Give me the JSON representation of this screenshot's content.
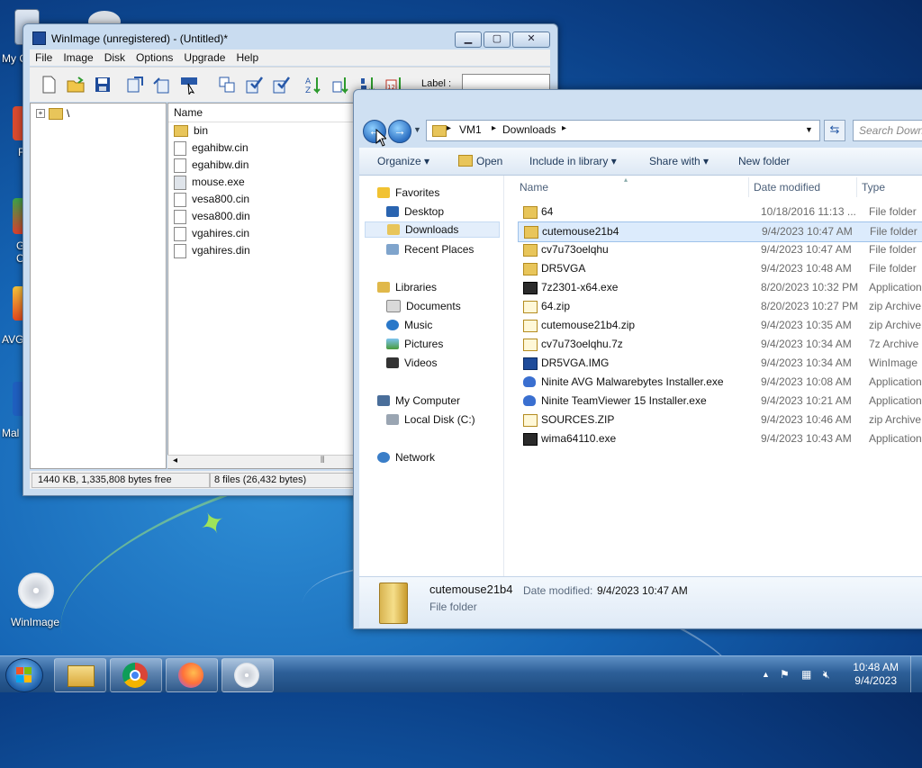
{
  "desktop": {
    "icons": [
      {
        "label": "My C"
      },
      {
        "label": "F"
      },
      {
        "label": "G"
      },
      {
        "label": "C"
      },
      {
        "label": "AVG"
      },
      {
        "label": "Mal"
      },
      {
        "label": "WinImage"
      }
    ]
  },
  "winimage": {
    "title": "WinImage (unregistered) - (Untitled)*",
    "menu": [
      "File",
      "Image",
      "Disk",
      "Options",
      "Upgrade",
      "Help"
    ],
    "label_caption": "Label :",
    "label_value": "",
    "tree_root": "\\",
    "list_header": "Name",
    "files": [
      {
        "name": "bin",
        "kind": "folder"
      },
      {
        "name": "egahibw.cin",
        "kind": "file"
      },
      {
        "name": "egahibw.din",
        "kind": "file"
      },
      {
        "name": "mouse.exe",
        "kind": "exe"
      },
      {
        "name": "vesa800.cin",
        "kind": "file"
      },
      {
        "name": "vesa800.din",
        "kind": "file"
      },
      {
        "name": "vgahires.cin",
        "kind": "file"
      },
      {
        "name": "vgahires.din",
        "kind": "file"
      }
    ],
    "status_left": "1440 KB, 1,335,808 bytes free",
    "status_right": "8 files (26,432 bytes)"
  },
  "explorer": {
    "breadcrumb": [
      "VM1",
      "Downloads"
    ],
    "search_placeholder": "Search Downlo",
    "commands": {
      "organize": "Organize",
      "open": "Open",
      "include": "Include in library",
      "share": "Share with",
      "new_folder": "New folder"
    },
    "nav": {
      "favorites": "Favorites",
      "desktop": "Desktop",
      "downloads": "Downloads",
      "recent": "Recent Places",
      "libraries": "Libraries",
      "documents": "Documents",
      "music": "Music",
      "pictures": "Pictures",
      "videos": "Videos",
      "computer": "My Computer",
      "localdisk": "Local Disk (C:)",
      "network": "Network"
    },
    "columns": {
      "name": "Name",
      "date": "Date modified",
      "type": "Type"
    },
    "files": [
      {
        "name": "64",
        "date": "10/18/2016 11:13 ...",
        "type": "File folder",
        "icon": "folder"
      },
      {
        "name": "cutemouse21b4",
        "date": "9/4/2023 10:47 AM",
        "type": "File folder",
        "icon": "folder"
      },
      {
        "name": "cv7u73oelqhu",
        "date": "9/4/2023 10:47 AM",
        "type": "File folder",
        "icon": "folder"
      },
      {
        "name": "DR5VGA",
        "date": "9/4/2023 10:48 AM",
        "type": "File folder",
        "icon": "folder"
      },
      {
        "name": "7z2301-x64.exe",
        "date": "8/20/2023 10:32 PM",
        "type": "Application",
        "icon": "app"
      },
      {
        "name": "64.zip",
        "date": "8/20/2023 10:27 PM",
        "type": "zip Archive",
        "icon": "archive"
      },
      {
        "name": "cutemouse21b4.zip",
        "date": "9/4/2023 10:35 AM",
        "type": "zip Archive",
        "icon": "archive"
      },
      {
        "name": "cv7u73oelqhu.7z",
        "date": "9/4/2023 10:34 AM",
        "type": "7z Archive",
        "icon": "archive"
      },
      {
        "name": "DR5VGA.IMG",
        "date": "9/4/2023 10:34 AM",
        "type": "WinImage",
        "icon": "disk"
      },
      {
        "name": "Ninite AVG Malwarebytes Installer.exe",
        "date": "9/4/2023 10:08 AM",
        "type": "Application",
        "icon": "ninite"
      },
      {
        "name": "Ninite TeamViewer 15 Installer.exe",
        "date": "9/4/2023 10:21 AM",
        "type": "Application",
        "icon": "ninite"
      },
      {
        "name": "SOURCES.ZIP",
        "date": "9/4/2023 10:46 AM",
        "type": "zip Archive",
        "icon": "archive"
      },
      {
        "name": "wima64110.exe",
        "date": "9/4/2023 10:43 AM",
        "type": "Application",
        "icon": "app"
      }
    ],
    "selected_index": 1,
    "details": {
      "name": "cutemouse21b4",
      "date_label": "Date modified:",
      "date_value": "9/4/2023 10:47 AM",
      "type": "File folder"
    }
  },
  "taskbar": {
    "time": "10:48 AM",
    "date": "9/4/2023"
  },
  "colors": {
    "folder": "#e8c55a",
    "selection": "#dcebfc",
    "taskbar": "#2d5f98"
  }
}
